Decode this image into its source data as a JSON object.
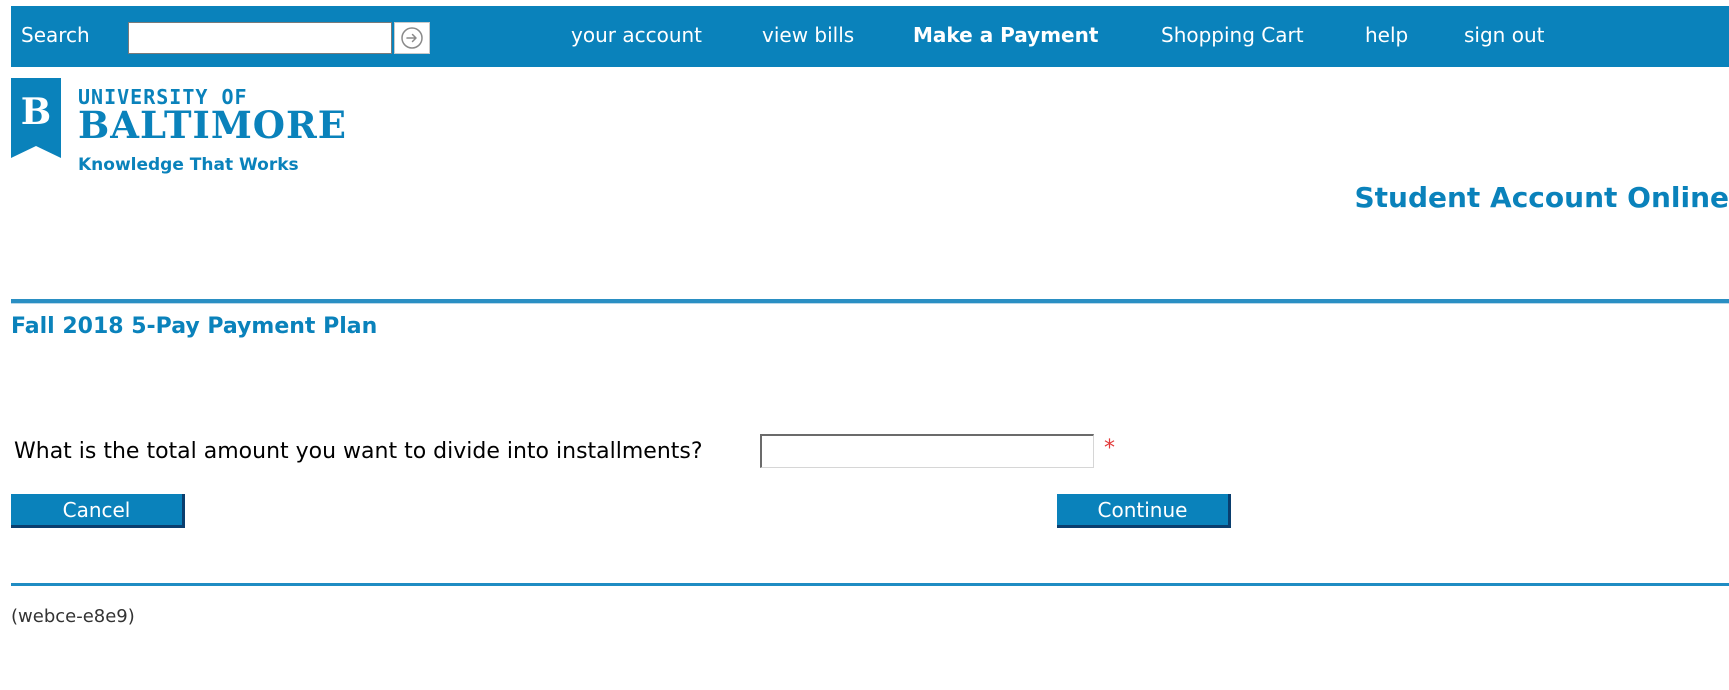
{
  "topbar": {
    "search_label": "Search",
    "search_value": "",
    "search_go_icon": "arrow-circle-right-icon",
    "nav": [
      {
        "label": "your account",
        "bold": false
      },
      {
        "label": "view bills",
        "bold": false
      },
      {
        "label": "Make a Payment",
        "bold": true
      },
      {
        "label": "Shopping Cart",
        "bold": false
      },
      {
        "label": "help",
        "bold": false
      },
      {
        "label": "sign out",
        "bold": false
      }
    ]
  },
  "brand": {
    "logo_letter": "B",
    "line1": "UNIVERSITY OF",
    "line2": "BALTIMORE",
    "tagline": "Knowledge That Works",
    "app_title": "Student Account Online"
  },
  "main": {
    "plan_title": "Fall 2018 5-Pay Payment Plan",
    "question": "What is the total amount you want to divide into installments?",
    "amount_value": "",
    "required_marker": "*",
    "cancel_label": "Cancel",
    "continue_label": "Continue"
  },
  "footer": {
    "code": "(webce-e8e9)"
  },
  "colors": {
    "brand_blue": "#0a82bb",
    "button_shadow": "#0a3e6e",
    "required_red": "#e23a3a"
  }
}
